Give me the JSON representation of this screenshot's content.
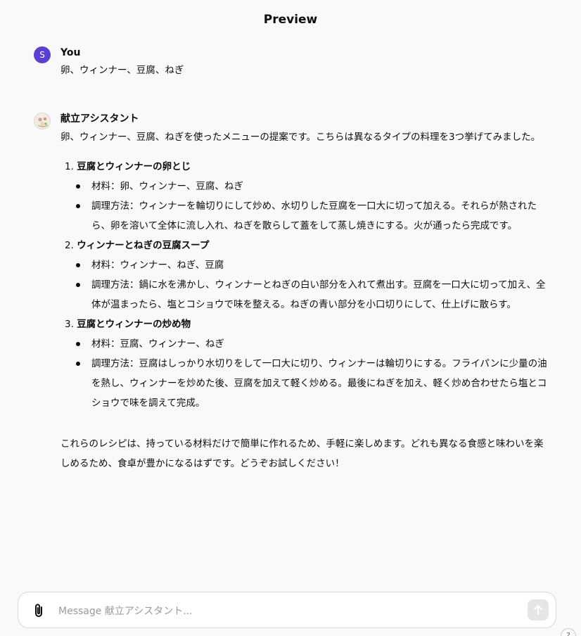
{
  "header": {
    "title": "Preview"
  },
  "user_message": {
    "avatar_letter": "S",
    "author": "You",
    "text": "卵、ウィンナー、豆腐、ねぎ"
  },
  "assistant_message": {
    "author": "献立アシスタント",
    "intro": "卵、ウィンナー、豆腐、ねぎを使ったメニューの提案です。こちらは異なるタイプの料理を3つ挙げてみました。",
    "dishes": [
      {
        "number": "1.",
        "title": "豆腐とウィンナーの卵とじ",
        "ingredients": "材料：卵、ウィンナー、豆腐、ねぎ",
        "method": "調理方法：ウィンナーを輪切りにして炒め、水切りした豆腐を一口大に切って加える。それらが熱されたら、卵を溶いて全体に流し入れ、ねぎを散らして蓋をして蒸し焼きにする。火が通ったら完成です。"
      },
      {
        "number": "2.",
        "title": "ウィンナーとねぎの豆腐スープ",
        "ingredients": "材料：ウィンナー、ねぎ、豆腐",
        "method": "調理方法：鍋に水を沸かし、ウィンナーとねぎの白い部分を入れて煮出す。豆腐を一口大に切って加え、全体が温まったら、塩とコショウで味を整える。ねぎの青い部分を小口切りにして、仕上げに散らす。"
      },
      {
        "number": "3.",
        "title": "豆腐とウィンナーの炒め物",
        "ingredients": "材料：豆腐、ウィンナー、ねぎ",
        "method": "調理方法：豆腐はしっかり水切りをして一口大に切り、ウィンナーは輪切りにする。フライパンに少量の油を熱し、ウィンナーを炒めた後、豆腐を加えて軽く炒める。最後にねぎを加え、軽く炒め合わせたら塩とコショウで味を調えて完成。"
      }
    ],
    "closing": "これらのレシピは、持っている材料だけで簡単に作れるため、手軽に楽しめます。どれも異なる食感と味わいを楽しめるため、食卓が豊かになるはずです。どうぞお試しください！"
  },
  "composer": {
    "placeholder": "Message 献立アシスタント...",
    "attach_icon": "paperclip-icon",
    "send_icon": "arrow-up-icon"
  },
  "help": {
    "label": "?"
  },
  "colors": {
    "background": "#f9f9f9",
    "user_avatar": "#5b3fd0",
    "send_button": "#e5e5e5"
  }
}
